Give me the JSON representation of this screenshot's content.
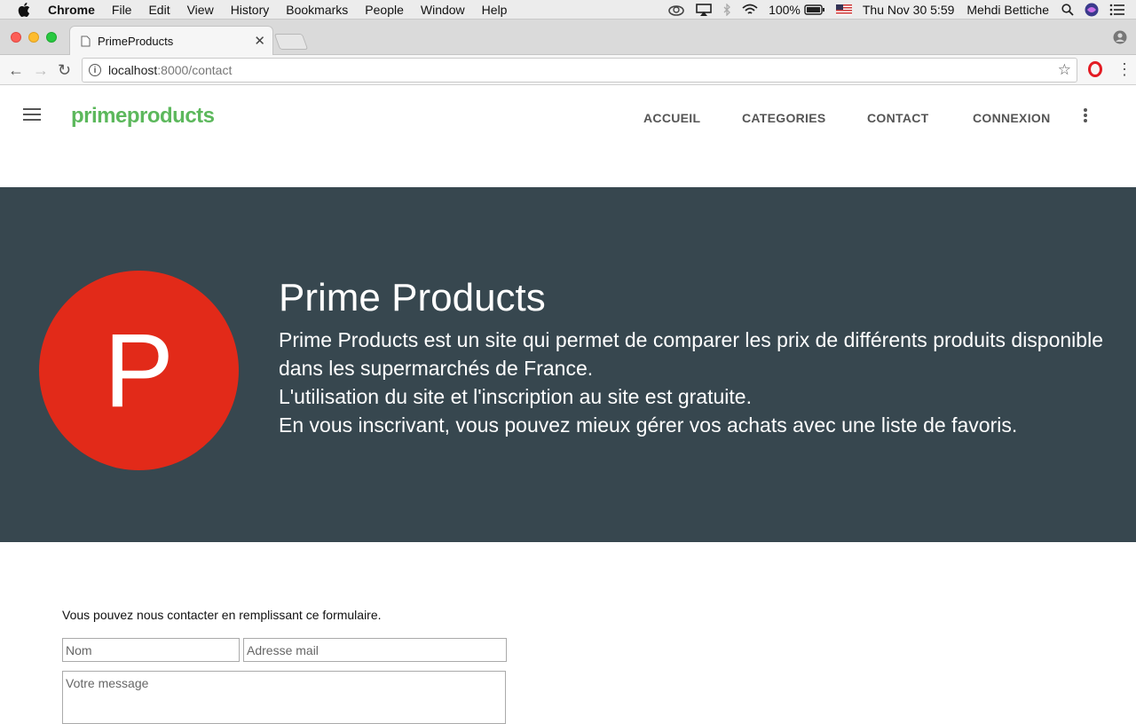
{
  "menubar": {
    "app": "Chrome",
    "items": [
      "File",
      "Edit",
      "View",
      "History",
      "Bookmarks",
      "People",
      "Window",
      "Help"
    ],
    "battery": "100%",
    "datetime": "Thu Nov 30  5:59",
    "user": "Mehdi Bettiche"
  },
  "browser": {
    "tab_title": "PrimeProducts",
    "url_host": "localhost",
    "url_path": ":8000/contact"
  },
  "site": {
    "brand": "primeproducts",
    "nav": [
      "ACCUEIL",
      "CATEGORIES",
      "CONTACT",
      "CONNEXION"
    ]
  },
  "hero": {
    "avatar_letter": "P",
    "avatar_color": "#e22a19",
    "title": "Prime Products",
    "lines": [
      "Prime Products est un site qui permet de comparer les prix de différents produits disponible",
      "dans les supermarchés de France.",
      "L'utilisation du site et l'inscription au site est gratuite.",
      "En vous inscrivant, vous pouvez mieux gérer vos achats avec une liste de favoris."
    ],
    "bg": "#37474f"
  },
  "contact": {
    "intro": "Vous pouvez nous contacter en remplissant ce formulaire.",
    "name_placeholder": "Nom",
    "email_placeholder": "Adresse mail",
    "message_placeholder": "Votre message"
  },
  "colors": {
    "brand": "#5cb85c"
  }
}
